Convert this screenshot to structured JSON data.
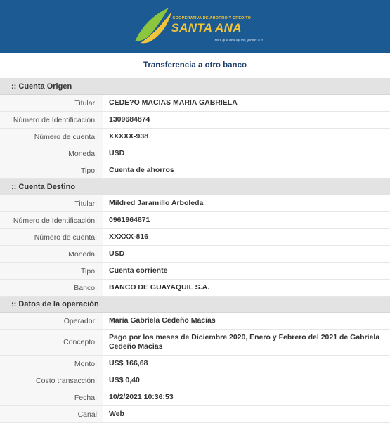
{
  "header": {
    "brand_top": "COOPERATIVA DE AHORRO Y CRÉDITO",
    "brand_name": "SANTA ANA",
    "slogan": "Más que una ayuda, juntos a ti..."
  },
  "page": {
    "title": "Transferencia a otro banco"
  },
  "origen": {
    "header": ":: Cuenta Origen",
    "rows": [
      {
        "label": "Titular:",
        "value": "CEDE?O MACIAS MARIA GABRIELA"
      },
      {
        "label": "Número de Identificación:",
        "value": "1309684874"
      },
      {
        "label": "Número de cuenta:",
        "value": "XXXXX-938"
      },
      {
        "label": "Moneda:",
        "value": "USD"
      },
      {
        "label": "Tipo:",
        "value": "Cuenta de ahorros"
      }
    ]
  },
  "destino": {
    "header": ":: Cuenta Destino",
    "rows": [
      {
        "label": "Titular:",
        "value": "Mildred Jaramillo Arboleda"
      },
      {
        "label": "Número de Identificación:",
        "value": "0961964871"
      },
      {
        "label": "Número de cuenta:",
        "value": "XXXXX-816"
      },
      {
        "label": "Moneda:",
        "value": "USD"
      },
      {
        "label": "Tipo:",
        "value": "Cuenta corriente"
      },
      {
        "label": "Banco:",
        "value": "BANCO DE GUAYAQUIL S.A."
      }
    ]
  },
  "operacion": {
    "header": ":: Datos de la operación",
    "rows": [
      {
        "label": "Operador:",
        "value": "María Gabriela Cedeño Macías"
      },
      {
        "label": "Concepto:",
        "value": "Pago por los meses de Diciembre 2020, Enero y Febrero del 2021 de Gabriela Cedeño Macias"
      },
      {
        "label": "Monto:",
        "value": "US$ 166,68"
      },
      {
        "label": "Costo transacción:",
        "value": "US$ 0,40"
      },
      {
        "label": "Fecha:",
        "value": "10/2/2021 10:36:53"
      },
      {
        "label": "Canal",
        "value": "Web"
      }
    ]
  },
  "colors": {
    "header_bg": "#1b5a92",
    "brand_yellow": "#f2c43a",
    "brand_green": "#8cc63f",
    "section_bg": "#e3e3e3"
  }
}
